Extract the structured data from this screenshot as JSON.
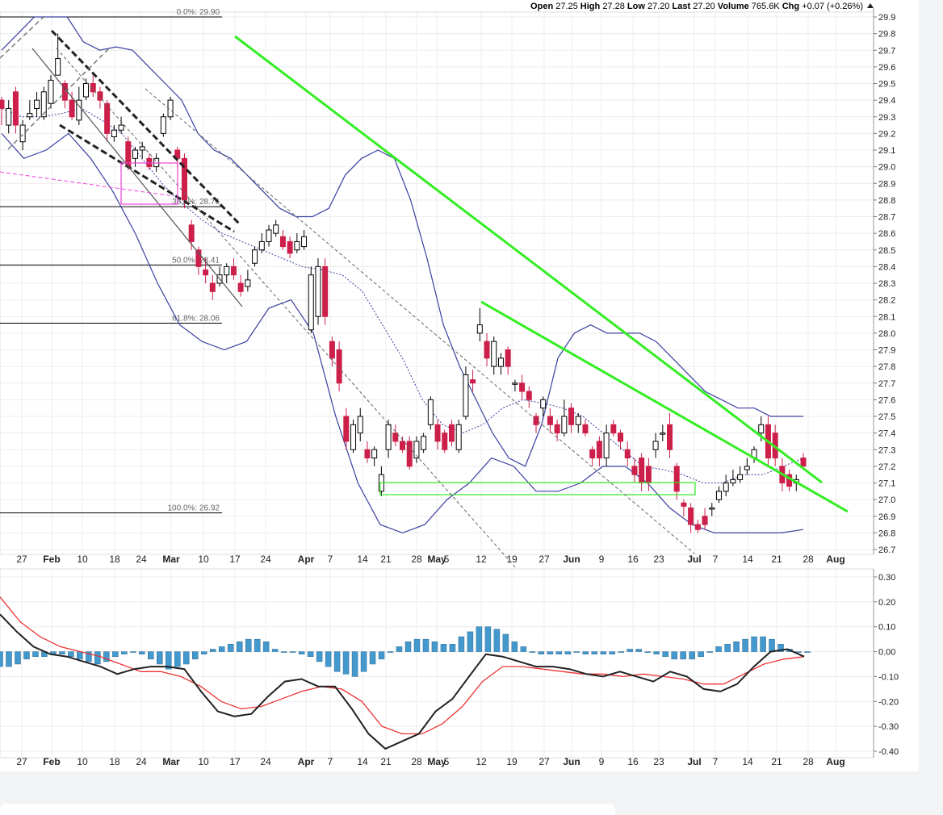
{
  "header": {
    "items": [
      {
        "label": "Open",
        "value": "27.25"
      },
      {
        "label": "High",
        "value": "27.28"
      },
      {
        "label": "Low",
        "value": "27.20"
      },
      {
        "label": "Last",
        "value": "27.20"
      },
      {
        "label": "Volume",
        "value": "765.6K"
      },
      {
        "label": "Chg",
        "value": "+0.07 (+0.26%)"
      }
    ],
    "arrow_icon": "triangle-up-icon"
  },
  "fib_levels": [
    {
      "label": "0.0%: 29.90",
      "price": 29.9
    },
    {
      "label": "38.2%: 28.76",
      "price": 28.76
    },
    {
      "label": "50.0%: 28.41",
      "price": 28.41
    },
    {
      "label": "61.8%: 28.06",
      "price": 28.06
    },
    {
      "label": "100.0%: 26.92",
      "price": 26.92
    }
  ],
  "date_labels": [
    {
      "text": "27",
      "bold": false
    },
    {
      "text": "Feb",
      "bold": true
    },
    {
      "text": "10",
      "bold": false
    },
    {
      "text": "18",
      "bold": false
    },
    {
      "text": "24",
      "bold": false
    },
    {
      "text": "Mar",
      "bold": true
    },
    {
      "text": "10",
      "bold": false
    },
    {
      "text": "17",
      "bold": false
    },
    {
      "text": "24",
      "bold": false
    },
    {
      "text": "Apr",
      "bold": true
    },
    {
      "text": "7",
      "bold": false
    },
    {
      "text": "14",
      "bold": false
    },
    {
      "text": "21",
      "bold": false
    },
    {
      "text": "28",
      "bold": false
    },
    {
      "text": "May",
      "bold": true
    },
    {
      "text": "5",
      "bold": false
    },
    {
      "text": "12",
      "bold": false
    },
    {
      "text": "19",
      "bold": false
    },
    {
      "text": "27",
      "bold": false
    },
    {
      "text": "Jun",
      "bold": true
    },
    {
      "text": "9",
      "bold": false
    },
    {
      "text": "16",
      "bold": false
    },
    {
      "text": "23",
      "bold": false
    },
    {
      "text": "Jul",
      "bold": true
    },
    {
      "text": "7",
      "bold": false
    },
    {
      "text": "14",
      "bold": false
    },
    {
      "text": "21",
      "bold": false
    },
    {
      "text": "28",
      "bold": false
    },
    {
      "text": "Aug",
      "bold": true
    }
  ],
  "colors": {
    "up_candle": "#000000",
    "down_candle": "#cc1f4a",
    "bollinger": "#3a3fa0",
    "trendline": "#33ee22",
    "macd_line": "#222222",
    "signal_line": "#ee3333",
    "histogram": "#4499cc",
    "fib_line": "#000000",
    "magenta": "#ee44dd"
  },
  "chart_data": [
    {
      "type": "candlestick",
      "ylim": [
        26.7,
        29.9
      ],
      "y_ticks": [
        "29.9",
        "29.8",
        "29.7",
        "29.6",
        "29.5",
        "29.4",
        "29.3",
        "29.2",
        "29.1",
        "29.0",
        "28.9",
        "28.8",
        "28.7",
        "28.6",
        "28.5",
        "28.4",
        "28.3",
        "28.2",
        "28.1",
        "28.0",
        "27.9",
        "27.8",
        "27.7",
        "27.6",
        "27.5",
        "27.4",
        "27.3",
        "27.2",
        "27.1",
        "27.0",
        "26.9",
        "26.8",
        "26.7"
      ],
      "candles": [
        [
          29.4,
          29.35,
          29.42,
          29.25
        ],
        [
          29.25,
          29.35,
          29.4,
          29.2
        ],
        [
          29.45,
          29.25,
          29.48,
          29.2
        ],
        [
          29.15,
          29.25,
          29.28,
          29.1
        ],
        [
          29.3,
          29.32,
          29.4,
          29.28
        ],
        [
          29.35,
          29.4,
          29.45,
          29.3
        ],
        [
          29.3,
          29.45,
          29.48,
          29.28
        ],
        [
          29.38,
          29.52,
          29.55,
          29.35
        ],
        [
          29.55,
          29.65,
          29.8,
          29.55
        ],
        [
          29.5,
          29.4,
          29.52,
          29.35
        ],
        [
          29.4,
          29.3,
          29.45,
          29.28
        ],
        [
          29.28,
          29.4,
          29.48,
          29.25
        ],
        [
          29.42,
          29.5,
          29.53,
          29.4
        ],
        [
          29.5,
          29.45,
          29.55,
          29.42
        ],
        [
          29.45,
          29.4,
          29.48,
          29.35
        ],
        [
          29.38,
          29.2,
          29.4,
          29.15
        ],
        [
          29.18,
          29.22,
          29.25,
          29.15
        ],
        [
          29.22,
          29.25,
          29.3,
          29.2
        ],
        [
          29.15,
          29.0,
          29.18,
          28.98
        ],
        [
          29.05,
          29.1,
          29.12,
          29.0
        ],
        [
          29.1,
          29.12,
          29.15,
          29.05
        ],
        [
          29.05,
          29.0,
          29.08,
          28.98
        ],
        [
          29.0,
          29.05,
          29.08,
          28.97
        ],
        [
          29.2,
          29.3,
          29.32,
          29.18
        ],
        [
          29.3,
          29.4,
          29.42,
          29.28
        ],
        [
          29.1,
          29.05,
          29.12,
          29.0
        ],
        [
          29.05,
          28.8,
          29.08,
          28.75
        ],
        [
          28.65,
          28.55,
          28.68,
          28.5
        ],
        [
          28.5,
          28.4,
          28.52,
          28.35
        ],
        [
          28.38,
          28.35,
          28.45,
          28.3
        ],
        [
          28.3,
          28.25,
          28.35,
          28.2
        ],
        [
          28.3,
          28.35,
          28.4,
          28.28
        ],
        [
          28.35,
          28.4,
          28.42,
          28.3
        ],
        [
          28.4,
          28.35,
          28.45,
          28.32
        ],
        [
          28.3,
          28.25,
          28.35,
          28.22
        ],
        [
          28.28,
          28.32,
          28.38,
          28.25
        ],
        [
          28.42,
          28.5,
          28.52,
          28.4
        ],
        [
          28.5,
          28.55,
          28.6,
          28.48
        ],
        [
          28.55,
          28.62,
          28.65,
          28.52
        ],
        [
          28.6,
          28.65,
          28.68,
          28.58
        ],
        [
          28.58,
          28.52,
          28.62,
          28.5
        ],
        [
          28.55,
          28.48,
          28.58,
          28.45
        ],
        [
          28.5,
          28.55,
          28.6,
          28.48
        ],
        [
          28.52,
          28.58,
          28.62,
          28.5
        ],
        [
          28.02,
          28.35,
          28.4,
          28.0
        ],
        [
          28.1,
          28.4,
          28.45,
          28.05
        ],
        [
          28.4,
          28.1,
          28.45,
          28.05
        ],
        [
          27.95,
          27.85,
          27.98,
          27.8
        ],
        [
          27.9,
          27.7,
          27.95,
          27.65
        ],
        [
          27.5,
          27.35,
          27.55,
          27.3
        ],
        [
          27.3,
          27.45,
          27.48,
          27.28
        ],
        [
          27.4,
          27.5,
          27.55,
          27.35
        ],
        [
          27.3,
          27.25,
          27.35,
          27.22
        ],
        [
          27.25,
          27.3,
          27.32,
          27.2
        ],
        [
          27.05,
          27.15,
          27.2,
          27.02
        ],
        [
          27.3,
          27.45,
          27.48,
          27.25
        ],
        [
          27.4,
          27.35,
          27.45,
          27.32
        ],
        [
          27.35,
          27.3,
          27.38,
          27.28
        ],
        [
          27.35,
          27.2,
          27.38,
          27.18
        ],
        [
          27.25,
          27.35,
          27.38,
          27.22
        ],
        [
          27.3,
          27.38,
          27.4,
          27.28
        ],
        [
          27.45,
          27.6,
          27.62,
          27.42
        ],
        [
          27.45,
          27.35,
          27.48,
          27.3
        ],
        [
          27.4,
          27.3,
          27.42,
          27.28
        ],
        [
          27.45,
          27.35,
          27.48,
          27.32
        ],
        [
          27.3,
          27.45,
          27.48,
          27.28
        ],
        [
          27.5,
          27.75,
          27.8,
          27.48
        ],
        [
          27.72,
          27.7,
          27.78,
          27.65
        ],
        [
          28.0,
          28.05,
          28.15,
          27.95
        ],
        [
          27.95,
          27.85,
          28.0,
          27.8
        ],
        [
          27.8,
          27.95,
          27.98,
          27.75
        ],
        [
          27.8,
          27.85,
          27.88,
          27.75
        ],
        [
          27.9,
          27.8,
          27.92,
          27.75
        ],
        [
          27.7,
          27.7,
          27.72,
          27.65
        ],
        [
          27.7,
          27.65,
          27.75,
          27.6
        ],
        [
          27.65,
          27.6,
          27.68,
          27.55
        ],
        [
          27.5,
          27.45,
          27.52,
          27.4
        ],
        [
          27.55,
          27.6,
          27.62,
          27.5
        ],
        [
          27.5,
          27.45,
          27.55,
          27.4
        ],
        [
          27.45,
          27.4,
          27.48,
          27.35
        ],
        [
          27.4,
          27.5,
          27.6,
          27.38
        ],
        [
          27.55,
          27.45,
          27.58,
          27.4
        ],
        [
          27.45,
          27.5,
          27.52,
          27.4
        ],
        [
          27.45,
          27.4,
          27.48,
          27.38
        ],
        [
          27.3,
          27.25,
          27.32,
          27.2
        ],
        [
          27.35,
          27.25,
          27.38,
          27.2
        ],
        [
          27.25,
          27.4,
          27.45,
          27.2
        ],
        [
          27.45,
          27.4,
          27.48,
          27.38
        ],
        [
          27.4,
          27.35,
          27.42,
          27.3
        ],
        [
          27.3,
          27.25,
          27.35,
          27.2
        ],
        [
          27.2,
          27.15,
          27.25,
          27.1
        ],
        [
          27.25,
          27.1,
          27.28,
          27.05
        ],
        [
          27.2,
          27.1,
          27.25,
          27.05
        ],
        [
          27.3,
          27.35,
          27.4,
          27.25
        ],
        [
          27.4,
          27.4,
          27.45,
          27.35
        ],
        [
          27.45,
          27.3,
          27.52,
          27.25
        ],
        [
          27.2,
          27.05,
          27.22,
          27.0
        ],
        [
          26.98,
          26.96,
          27.0,
          26.9
        ],
        [
          26.95,
          26.85,
          26.98,
          26.8
        ],
        [
          26.85,
          26.82,
          26.88,
          26.8
        ],
        [
          26.9,
          26.85,
          26.95,
          26.82
        ],
        [
          26.95,
          26.95,
          26.98,
          26.9
        ],
        [
          27.0,
          27.05,
          27.08,
          26.98
        ],
        [
          27.05,
          27.1,
          27.15,
          27.02
        ],
        [
          27.1,
          27.12,
          27.18,
          27.08
        ],
        [
          27.12,
          27.15,
          27.2,
          27.1
        ],
        [
          27.18,
          27.2,
          27.25,
          27.15
        ],
        [
          27.25,
          27.3,
          27.32,
          27.22
        ],
        [
          27.4,
          27.45,
          27.5,
          27.35
        ],
        [
          27.45,
          27.25,
          27.5,
          27.2
        ],
        [
          27.4,
          27.25,
          27.45,
          27.2
        ],
        [
          27.2,
          27.1,
          27.25,
          27.05
        ],
        [
          27.15,
          27.08,
          27.18,
          27.05
        ],
        [
          27.1,
          27.12,
          27.15,
          27.05
        ],
        [
          27.25,
          27.2,
          27.28,
          27.2
        ]
      ],
      "bollinger_upper": [
        29.7,
        29.8,
        29.9,
        29.9,
        29.9,
        29.75,
        29.7,
        29.72,
        29.7,
        29.6,
        29.5,
        29.4,
        29.2,
        29.1,
        29.05,
        28.95,
        28.85,
        28.75,
        28.7,
        28.7,
        28.75,
        28.95,
        29.05,
        29.1,
        29.05,
        28.8,
        28.45,
        28.05,
        27.8,
        27.6,
        27.4,
        27.25,
        27.2,
        27.45,
        27.85,
        28.0,
        28.05,
        28.0,
        28.0,
        28.0,
        27.95,
        27.85,
        27.75,
        27.65,
        27.6,
        27.55,
        27.55,
        27.5,
        27.5,
        27.5
      ],
      "bollinger_middle": [
        29.35,
        29.3,
        29.3,
        29.32,
        29.35,
        29.28,
        29.2,
        29.05,
        28.9,
        28.78,
        28.68,
        28.6,
        28.55,
        28.5,
        28.45,
        28.4,
        28.38,
        28.35,
        28.25,
        28.05,
        27.85,
        27.6,
        27.45,
        27.4,
        27.45,
        27.55,
        27.6,
        27.58,
        27.55,
        27.5,
        27.4,
        27.3,
        27.2,
        27.18,
        27.15,
        27.1,
        27.1,
        27.15,
        27.15,
        27.2,
        27.25
      ],
      "bollinger_lower": [
        29.2,
        29.05,
        29.1,
        29.2,
        29.05,
        28.85,
        28.6,
        28.3,
        28.05,
        27.95,
        27.9,
        27.95,
        28.15,
        28.2,
        28.0,
        27.5,
        27.1,
        26.85,
        26.8,
        26.85,
        27.0,
        27.1,
        27.25,
        27.2,
        27.05,
        27.05,
        27.1,
        27.2,
        27.2,
        27.1,
        26.95,
        26.85,
        26.8,
        26.8,
        26.8,
        26.8,
        26.82
      ]
    },
    {
      "type": "macd",
      "ylim": [
        -0.4,
        0.3
      ],
      "y_ticks": [
        "0.30",
        "0.20",
        "0.10",
        "0.00",
        "-0.10",
        "-0.20",
        "-0.30",
        "-0.40"
      ],
      "macd_line": [
        0.15,
        0.08,
        0.02,
        -0.01,
        -0.02,
        -0.04,
        -0.06,
        -0.09,
        -0.07,
        -0.06,
        -0.06,
        -0.07,
        -0.16,
        -0.24,
        -0.26,
        -0.25,
        -0.18,
        -0.12,
        -0.11,
        -0.14,
        -0.14,
        -0.23,
        -0.33,
        -0.39,
        -0.36,
        -0.33,
        -0.24,
        -0.19,
        -0.1,
        -0.01,
        -0.02,
        -0.04,
        -0.06,
        -0.06,
        -0.07,
        -0.09,
        -0.1,
        -0.08,
        -0.1,
        -0.12,
        -0.08,
        -0.1,
        -0.15,
        -0.16,
        -0.13,
        -0.06,
        0.0,
        0.01,
        -0.02
      ],
      "signal_line": [
        0.22,
        0.12,
        0.06,
        0.02,
        0.0,
        -0.02,
        -0.05,
        -0.08,
        -0.08,
        -0.1,
        -0.14,
        -0.2,
        -0.23,
        -0.22,
        -0.19,
        -0.16,
        -0.14,
        -0.15,
        -0.2,
        -0.3,
        -0.33,
        -0.33,
        -0.29,
        -0.22,
        -0.12,
        -0.06,
        -0.06,
        -0.07,
        -0.08,
        -0.09,
        -0.09,
        -0.1,
        -0.09,
        -0.1,
        -0.11,
        -0.13,
        -0.13,
        -0.09,
        -0.05,
        -0.03,
        -0.02
      ],
      "histogram": [
        -0.06,
        -0.06,
        -0.05,
        -0.03,
        -0.02,
        -0.02,
        -0.01,
        -0.01,
        -0.02,
        -0.03,
        -0.04,
        -0.05,
        -0.04,
        -0.02,
        -0.01,
        0.0,
        -0.01,
        -0.03,
        -0.05,
        -0.07,
        -0.06,
        -0.05,
        -0.03,
        -0.01,
        0.01,
        0.02,
        0.03,
        0.04,
        0.05,
        0.05,
        0.04,
        0.01,
        0.0,
        0.0,
        -0.01,
        -0.02,
        -0.04,
        -0.06,
        -0.08,
        -0.09,
        -0.1,
        -0.08,
        -0.05,
        -0.03,
        0.0,
        0.02,
        0.04,
        0.05,
        0.05,
        0.04,
        0.03,
        0.03,
        0.06,
        0.08,
        0.1,
        0.1,
        0.09,
        0.07,
        0.04,
        0.02,
        0.0,
        -0.01,
        -0.01,
        -0.01,
        -0.01,
        0.0,
        -0.01,
        -0.01,
        -0.01,
        -0.01,
        0.0,
        0.01,
        0.01,
        0.0,
        -0.01,
        -0.02,
        -0.03,
        -0.03,
        -0.03,
        -0.02,
        0.0,
        0.02,
        0.03,
        0.04,
        0.05,
        0.06,
        0.06,
        0.05,
        0.03,
        0.01,
        0.0,
        0.0
      ]
    }
  ]
}
